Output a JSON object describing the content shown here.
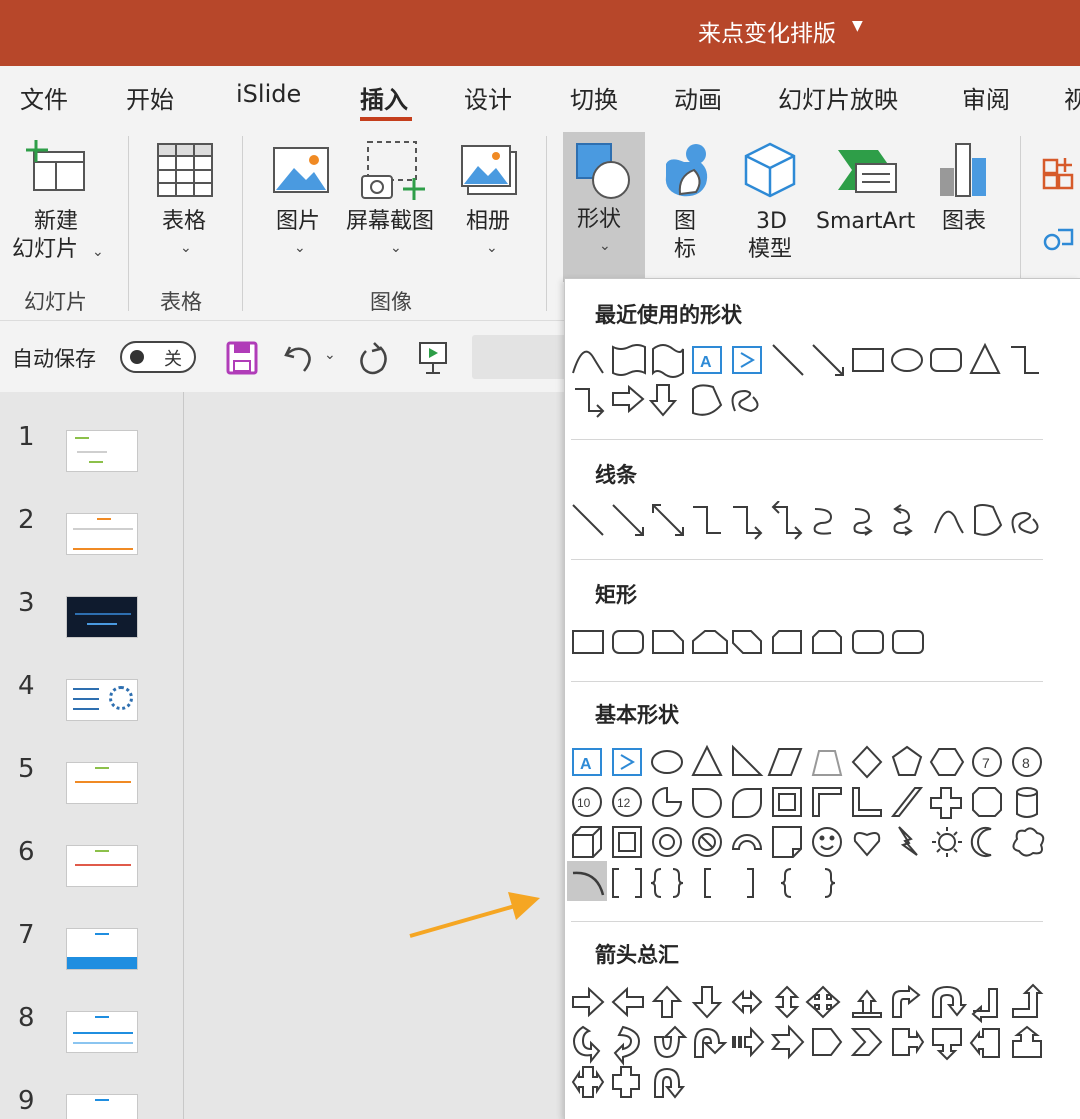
{
  "title_bar": {
    "document_title": "来点变化排版",
    "caret_icon": "chevron-down-icon",
    "background": "#b7472a"
  },
  "tabs": [
    {
      "label": "文件"
    },
    {
      "label": "开始"
    },
    {
      "label": "iSlide"
    },
    {
      "label": "插入",
      "active": true
    },
    {
      "label": "设计"
    },
    {
      "label": "切换"
    },
    {
      "label": "动画"
    },
    {
      "label": "幻灯片放映"
    },
    {
      "label": "审阅"
    },
    {
      "label": "视"
    }
  ],
  "ribbon": {
    "new_slide_line1": "新建",
    "new_slide_line2": "幻灯片",
    "group_slides": "幻灯片",
    "table": "表格",
    "group_table": "表格",
    "picture": "图片",
    "screenshot": "屏幕截图",
    "album": "相册",
    "group_images": "图像",
    "shapes": "形状",
    "icons_line1": "图",
    "icons_line2": "标",
    "model3d_line1": "3D",
    "model3d_line2": "模型",
    "smartart": "SmartArt",
    "chart": "图表",
    "accent": "#c43e1c"
  },
  "quick_access": {
    "autosave_label": "自动保存",
    "autosave_state": "关"
  },
  "slides": [
    {
      "number": "1"
    },
    {
      "number": "2"
    },
    {
      "number": "3"
    },
    {
      "number": "4"
    },
    {
      "number": "5"
    },
    {
      "number": "6"
    },
    {
      "number": "7"
    },
    {
      "number": "8"
    },
    {
      "number": "9"
    }
  ],
  "shapes_gallery": {
    "recent": "最近使用的形状",
    "lines": "线条",
    "rectangles": "矩形",
    "basic": "基本形状",
    "arrows": "箭头总汇"
  },
  "annotation": {
    "arrow_color": "#f5a623"
  }
}
